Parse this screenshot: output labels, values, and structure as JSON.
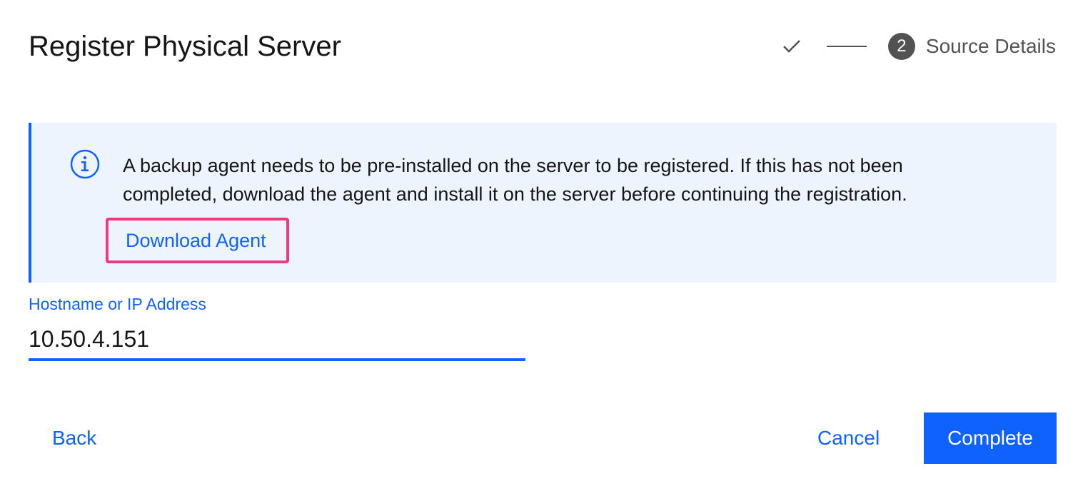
{
  "modal": {
    "title": "Register Physical Server"
  },
  "stepper": {
    "completed_icon": "checkmark-icon",
    "current_step_number": "2",
    "current_step_label": "Source Details"
  },
  "notification": {
    "kind": "info",
    "icon": "info-icon",
    "message": "A backup agent needs to be pre-installed on the server to be registered. If this has not been completed, download the agent and install it on the server before continuing the registration.",
    "link_label": "Download Agent",
    "highlight_color": "#f0397a"
  },
  "form": {
    "hostname_label": "Hostname or IP Address",
    "hostname_value": "10.50.4.151"
  },
  "footer": {
    "back_label": "Back",
    "cancel_label": "Cancel",
    "complete_label": "Complete"
  },
  "colors": {
    "accent": "#0f62fe",
    "notification_background": "#edf4fe",
    "text_primary": "#161616",
    "text_secondary": "#525252"
  }
}
